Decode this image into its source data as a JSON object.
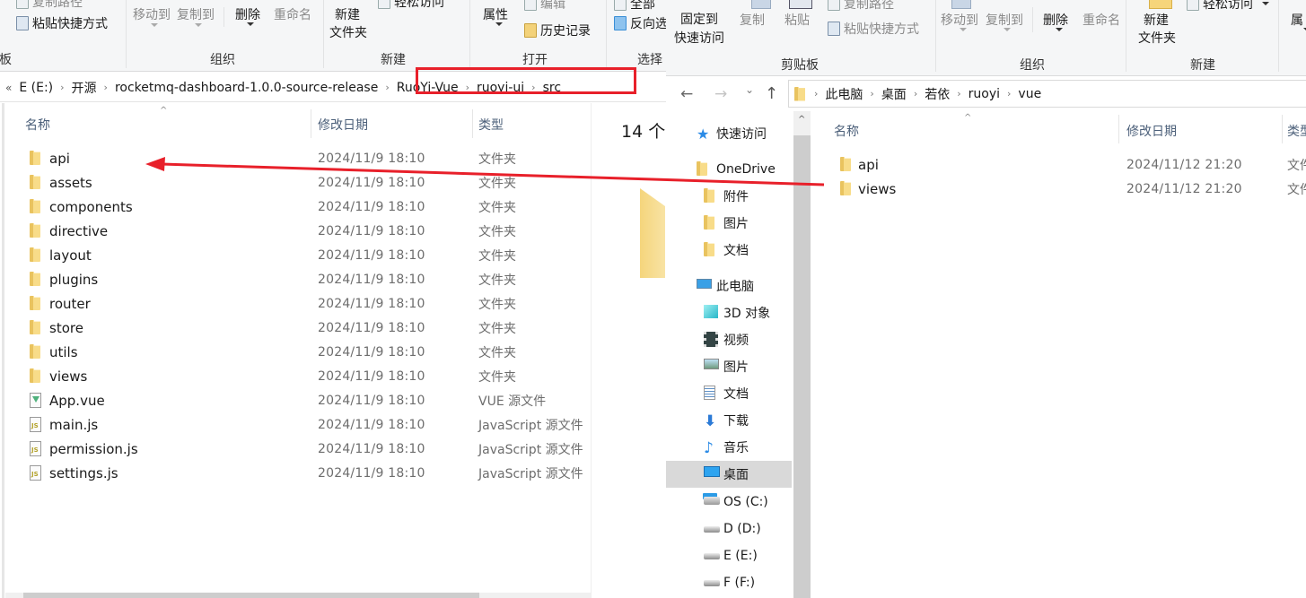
{
  "left_window": {
    "ribbon": {
      "clipboard": {
        "copy_path": "复制路径",
        "paste_shortcut": "粘贴快捷方式",
        "group_label_partial": "板"
      },
      "organize": {
        "move_to": "移动到",
        "copy_to": "复制到",
        "delete": "删除",
        "rename": "重命名",
        "group_label": "组织"
      },
      "new": {
        "new_folder_line1": "新建",
        "new_folder_line2": "文件夹",
        "easy_access": "轻松访问",
        "group_label": "新建"
      },
      "open": {
        "properties": "属性",
        "edit": "编辑",
        "history": "历史记录",
        "group_label": "打开"
      },
      "select": {
        "select_all_partial": "全部",
        "invert_partial": "反向选",
        "group_label": "选择"
      }
    },
    "breadcrumb": {
      "overflow": "«",
      "items": [
        "E (E:)",
        "开源",
        "rocketmq-dashboard-1.0.0-source-release",
        "RuoYi-Vue",
        "ruoyi-ui",
        "src"
      ]
    },
    "columns": {
      "name": "名称",
      "date": "修改日期",
      "type": "类型"
    },
    "item_count": "14 个",
    "files": [
      {
        "name": "api",
        "date": "2024/11/9 18:10",
        "type": "文件夹",
        "icon": "folder"
      },
      {
        "name": "assets",
        "date": "2024/11/9 18:10",
        "type": "文件夹",
        "icon": "folder"
      },
      {
        "name": "components",
        "date": "2024/11/9 18:10",
        "type": "文件夹",
        "icon": "folder"
      },
      {
        "name": "directive",
        "date": "2024/11/9 18:10",
        "type": "文件夹",
        "icon": "folder"
      },
      {
        "name": "layout",
        "date": "2024/11/9 18:10",
        "type": "文件夹",
        "icon": "folder"
      },
      {
        "name": "plugins",
        "date": "2024/11/9 18:10",
        "type": "文件夹",
        "icon": "folder"
      },
      {
        "name": "router",
        "date": "2024/11/9 18:10",
        "type": "文件夹",
        "icon": "folder"
      },
      {
        "name": "store",
        "date": "2024/11/9 18:10",
        "type": "文件夹",
        "icon": "folder"
      },
      {
        "name": "utils",
        "date": "2024/11/9 18:10",
        "type": "文件夹",
        "icon": "folder"
      },
      {
        "name": "views",
        "date": "2024/11/9 18:10",
        "type": "文件夹",
        "icon": "folder"
      },
      {
        "name": "App.vue",
        "date": "2024/11/9 18:10",
        "type": "VUE 源文件",
        "icon": "vue-file"
      },
      {
        "name": "main.js",
        "date": "2024/11/9 18:10",
        "type": "JavaScript 源文件",
        "icon": "js-file"
      },
      {
        "name": "permission.js",
        "date": "2024/11/9 18:10",
        "type": "JavaScript 源文件",
        "icon": "js-file"
      },
      {
        "name": "settings.js",
        "date": "2024/11/9 18:10",
        "type": "JavaScript 源文件",
        "icon": "js-file"
      }
    ]
  },
  "right_window": {
    "ribbon": {
      "clipboard": {
        "pin_line1": "固定到",
        "pin_line2": "快速访问",
        "copy": "复制",
        "paste": "粘贴",
        "copy_path": "复制路径",
        "paste_shortcut": "粘贴快捷方式",
        "group_label": "剪贴板"
      },
      "organize": {
        "move_to": "移动到",
        "copy_to": "复制到",
        "delete": "删除",
        "rename": "重命名",
        "group_label": "组织"
      },
      "new": {
        "new_folder_line1": "新建",
        "new_folder_line2": "文件夹",
        "easy_access": "轻松访问",
        "group_label": "新建"
      },
      "open": {
        "properties_partial": "属"
      }
    },
    "nav_buttons": {
      "back": "←",
      "forward": "→",
      "recent": "⌄",
      "up": "↑"
    },
    "breadcrumb": {
      "items": [
        "此电脑",
        "桌面",
        "若依",
        "ruoyi",
        "vue"
      ]
    },
    "nav_pane": [
      {
        "label": "快速访问",
        "icon": "star",
        "level": 0
      },
      {
        "label": "OneDrive",
        "icon": "folder",
        "level": 0
      },
      {
        "label": "附件",
        "icon": "folder",
        "level": 1
      },
      {
        "label": "图片",
        "icon": "folder",
        "level": 1
      },
      {
        "label": "文档",
        "icon": "folder",
        "level": 1
      },
      {
        "label": "此电脑",
        "icon": "computer",
        "level": 0
      },
      {
        "label": "3D 对象",
        "icon": "cube",
        "level": 1
      },
      {
        "label": "视频",
        "icon": "video",
        "level": 1
      },
      {
        "label": "图片",
        "icon": "picture",
        "level": 1
      },
      {
        "label": "文档",
        "icon": "document",
        "level": 1
      },
      {
        "label": "下载",
        "icon": "download",
        "level": 1
      },
      {
        "label": "音乐",
        "icon": "music",
        "level": 1
      },
      {
        "label": "桌面",
        "icon": "desktop",
        "level": 1,
        "selected": true
      },
      {
        "label": "OS (C:)",
        "icon": "os-drive",
        "level": 1
      },
      {
        "label": "D (D:)",
        "icon": "drive",
        "level": 1
      },
      {
        "label": "E (E:)",
        "icon": "drive",
        "level": 1
      },
      {
        "label": "F (F:)",
        "icon": "drive",
        "level": 1
      }
    ],
    "columns": {
      "name": "名称",
      "date": "修改日期",
      "type": "类型"
    },
    "files": [
      {
        "name": "api",
        "date": "2024/11/12 21:20",
        "type": "文件夹",
        "icon": "folder"
      },
      {
        "name": "views",
        "date": "2024/11/12 21:20",
        "type": "文件夹",
        "icon": "folder"
      }
    ]
  },
  "annotations": {
    "highlight_color": "#e8202a",
    "arrow_color": "#e8202a",
    "arrow_from": "right-window views folder",
    "arrow_to": "left-window api folder"
  }
}
